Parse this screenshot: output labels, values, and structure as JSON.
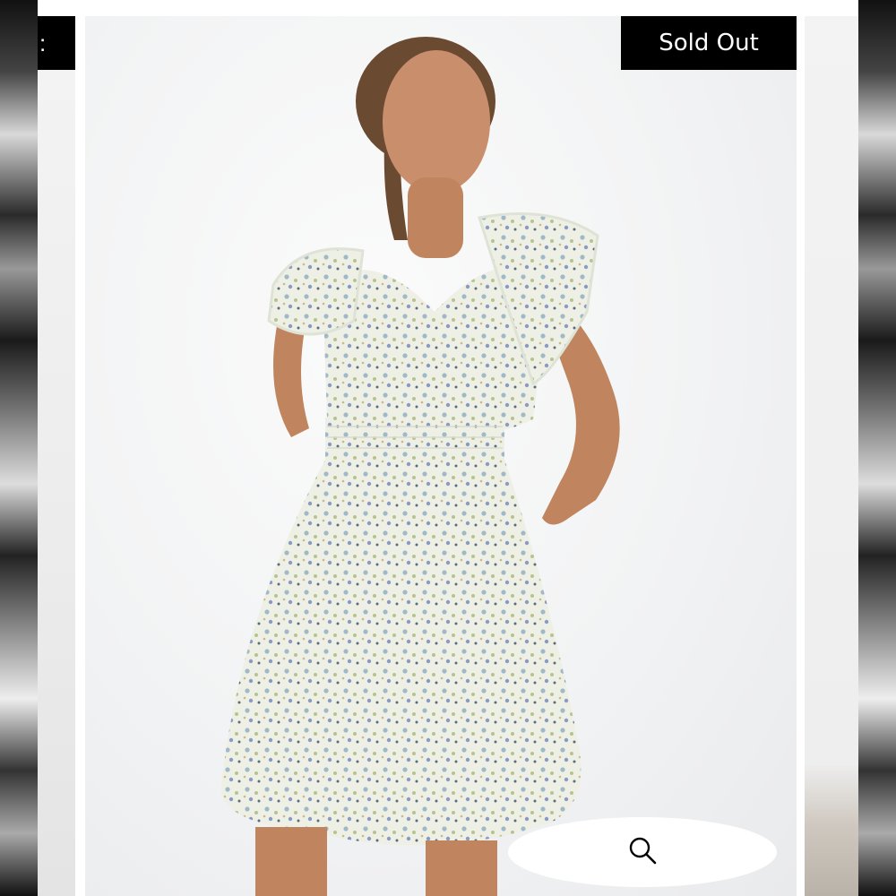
{
  "badge": {
    "sold_out_label": "Sold Out"
  },
  "carousel": {
    "prev_slide_label_fragment": ":"
  },
  "icons": {
    "search": "search-icon"
  },
  "colors": {
    "badge_bg": "#000000",
    "badge_text": "#ffffff",
    "pill_bg": "#ffffff"
  }
}
